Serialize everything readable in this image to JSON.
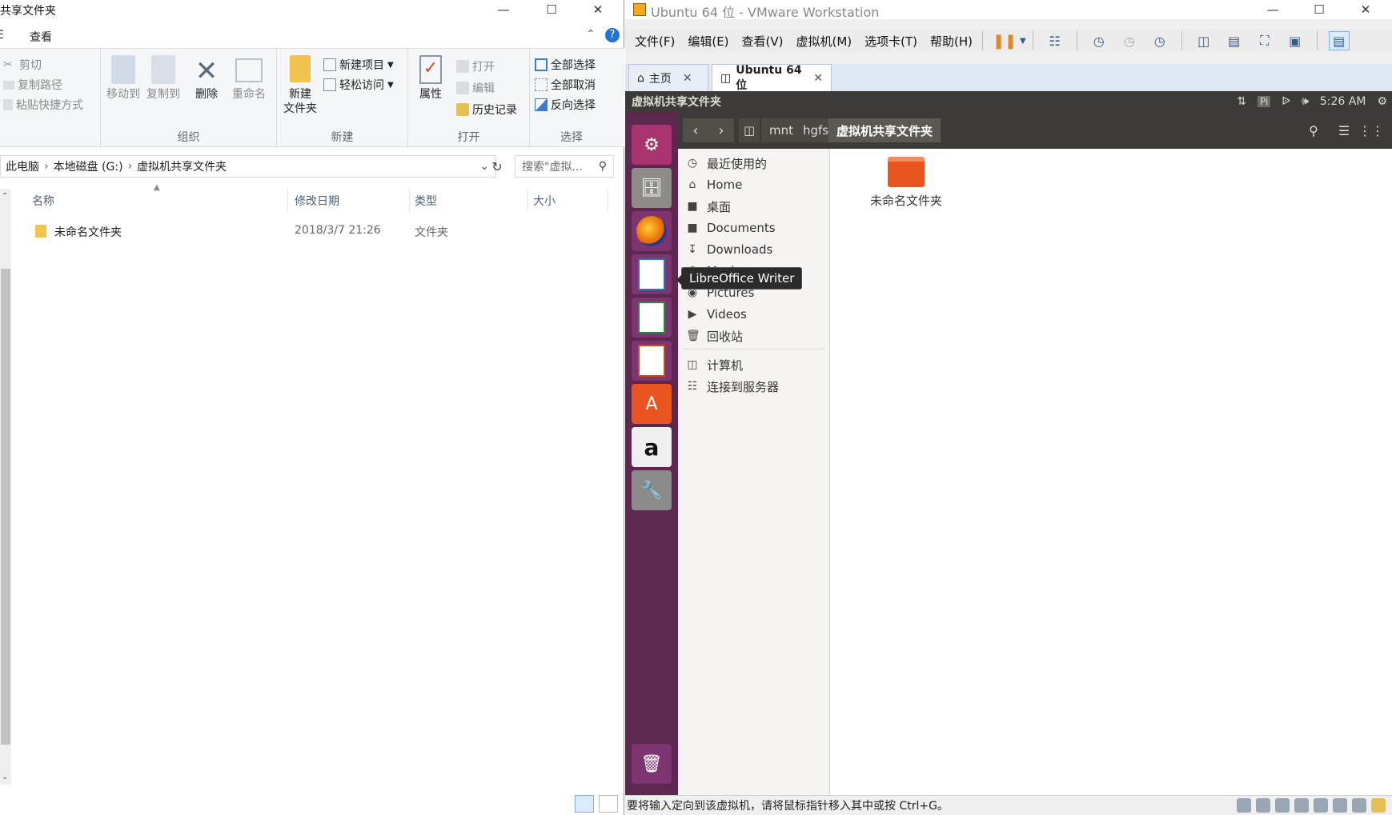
{
  "explorer": {
    "title": "共享文件夹",
    "menu": {
      "file_fragment": "E",
      "view": "查看"
    },
    "ribbon": {
      "cut": "剪切",
      "copy_path": "复制路径",
      "paste_shortcut": "粘贴快捷方式",
      "move_to": "移动到",
      "copy_to": "复制到",
      "delete": "删除",
      "rename": "重命名",
      "group_organize": "组织",
      "new_folder_line1": "新建",
      "new_folder_line2": "文件夹",
      "new_item": "新建项目",
      "easy_access": "轻松访问",
      "group_new": "新建",
      "properties": "属性",
      "open": "打开",
      "edit": "编辑",
      "history": "历史记录",
      "group_open": "打开",
      "select_all": "全部选择",
      "select_none": "全部取消",
      "invert_selection": "反向选择",
      "group_select": "选择"
    },
    "address": {
      "parts": [
        "此电脑",
        "本地磁盘 (G:)",
        "虚拟机共享文件夹"
      ]
    },
    "search_placeholder": "搜索\"虚拟...",
    "columns": {
      "name": "名称",
      "modified": "修改日期",
      "type": "类型",
      "size": "大小"
    },
    "rows": [
      {
        "name": "未命名文件夹",
        "modified": "2018/3/7 21:26",
        "type": "文件夹",
        "size": ""
      }
    ]
  },
  "vmware": {
    "title": "Ubuntu 64 位 - VMware Workstation",
    "menus": [
      "文件(F)",
      "编辑(E)",
      "查看(V)",
      "虚拟机(M)",
      "选项卡(T)",
      "帮助(H)"
    ],
    "tabs": [
      {
        "label": "主页"
      },
      {
        "label": "Ubuntu 64 位"
      }
    ],
    "status_text": "要将输入定向到该虚拟机，请将鼠标指针移入其中或按 Ctrl+G。"
  },
  "ubuntu": {
    "topbar_title": "虚拟机共享文件夹",
    "kb_indicator": "Pi",
    "clock": "5:26 AM",
    "breadcrumbs": [
      "mnt",
      "hgfs",
      "虚拟机共享文件夹"
    ],
    "sidebar": [
      {
        "label": "最近使用的",
        "icon": "clock-icon"
      },
      {
        "label": "Home",
        "icon": "home-icon"
      },
      {
        "label": "桌面",
        "icon": "desktop-folder-icon"
      },
      {
        "label": "Documents",
        "icon": "documents-icon"
      },
      {
        "label": "Downloads",
        "icon": "downloads-icon"
      },
      {
        "label": "Music",
        "icon": "music-icon"
      },
      {
        "label": "Pictures",
        "icon": "camera-icon"
      },
      {
        "label": "Videos",
        "icon": "videos-icon"
      },
      {
        "label": "回收站",
        "icon": "trash-icon"
      },
      {
        "label": "计算机",
        "icon": "computer-icon"
      },
      {
        "label": "连接到服务器",
        "icon": "server-icon"
      }
    ],
    "content": [
      {
        "name": "未命名文件夹"
      }
    ],
    "tooltip": "LibreOffice Writer"
  },
  "colors": {
    "ubuntu_launcher": "#5e2750",
    "ubuntu_panel": "#3c3b37",
    "folder_orange": "#e95420",
    "explorer_folder": "#f3c34f"
  }
}
